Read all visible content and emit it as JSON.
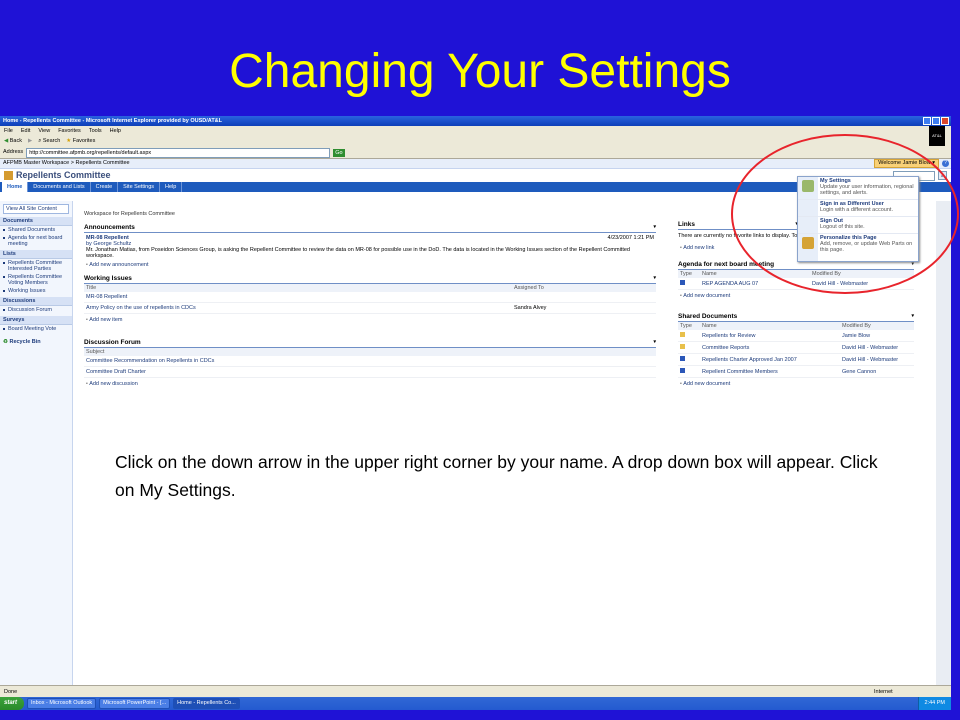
{
  "slide": {
    "title": "Changing Your Settings",
    "caption": "Click on the down arrow in the upper right corner by your name.  A drop down box will appear.  Click on My Settings."
  },
  "browser": {
    "title": "Home - Repellents Committee - Microsoft Internet Explorer provided by OUSD/AT&L",
    "menu": [
      "File",
      "Edit",
      "View",
      "Favorites",
      "Tools",
      "Help"
    ],
    "toolbar": [
      "Back",
      "Search",
      "Favorites"
    ],
    "address_label": "Address",
    "address": "http://committee.afpmb.org/repellents/default.aspx",
    "go_label": "Go",
    "logo": "AT&L"
  },
  "sharepoint": {
    "breadcrumb": "AFPMB Master Workspace > Repellents Committee",
    "welcome": "Welcome Jamie Blow ▾",
    "help": "?",
    "site_title": "Repellents Committee",
    "search_go": "⌕",
    "tabs": [
      "Home",
      "Documents and Lists",
      "Create",
      "Site Settings",
      "Help"
    ],
    "leftnav": {
      "view_all": "View All Site Content",
      "sections": [
        {
          "heading": "Documents",
          "items": [
            "Shared Documents",
            "Agenda for next board meeting"
          ]
        },
        {
          "heading": "Lists",
          "items": [
            "Repellents Committee Interested Parties",
            "Repellents Committee Voting Members",
            "Working Issues"
          ]
        },
        {
          "heading": "Discussions",
          "items": [
            "Discussion Forum"
          ]
        },
        {
          "heading": "Surveys",
          "items": [
            "Board Meeting Vote"
          ]
        }
      ],
      "recycle": "Recycle Bin"
    },
    "workspace_label": "Workspace for Repellents Committee",
    "announcements": {
      "title": "Announcements",
      "item_title": "MR-08 Repellent",
      "item_date": "4/23/2007 1:21 PM",
      "item_by": "by George Schultz",
      "item_body": "Mr. Jonathan Matias, from Poseidon Sciences Group, is asking the Repellent Committee to review the data on MR-08 for possible use in the DoD.  The data is located in the Working Issues section of the Repellent Committed workspace.",
      "add": "Add new announcement"
    },
    "working_issues": {
      "title": "Working Issues",
      "col_title": "Title",
      "col_assigned": "Assigned To",
      "rows": [
        {
          "title": "MR-08 Repellent",
          "assigned": ""
        },
        {
          "title": "Army Policy on the use of repellents in CDCs",
          "assigned": "Sandra Alvey"
        }
      ],
      "add": "Add new item"
    },
    "discussion": {
      "title": "Discussion Forum",
      "col_subject": "Subject",
      "rows": [
        "Committee Recommendation on Repellents in CDCs",
        "Committee Draft Charter"
      ],
      "add": "Add new discussion"
    },
    "links": {
      "title": "Links",
      "empty": "There are currently no favorite links to display. To",
      "add": "Add new link"
    },
    "agenda": {
      "title": "Agenda for next board meeting",
      "col_type": "Type",
      "col_name": "Name",
      "col_modified": "Modified By",
      "rows": [
        {
          "name": "REP AGENDA AUG 07",
          "modified": "David Hill - Webmaster"
        }
      ],
      "add": "Add new document"
    },
    "shared_docs": {
      "title": "Shared Documents",
      "col_type": "Type",
      "col_name": "Name",
      "col_modified": "Modified By",
      "rows": [
        {
          "name": "Repellents for Review",
          "modified": "Jamie Blow",
          "kind": "folder"
        },
        {
          "name": "Committee Reports",
          "modified": "David Hill - Webmaster",
          "kind": "folder"
        },
        {
          "name": "Repellents Charter Approved Jan 2007",
          "modified": "David Hill - Webmaster",
          "kind": "doc"
        },
        {
          "name": "Repellent Committee Members",
          "modified": "Gene Cannon",
          "kind": "doc"
        }
      ],
      "add": "Add new document"
    },
    "menu": [
      {
        "title": "My Settings",
        "desc": "Update your user information, regional settings, and alerts."
      },
      {
        "title": "Sign in as Different User",
        "desc": "Login with a different account."
      },
      {
        "title": "Sign Out",
        "desc": "Logout of this site."
      },
      {
        "title": "Personalize this Page",
        "desc": "Add, remove, or update Web Parts on this page."
      }
    ]
  },
  "status": {
    "left": "Done",
    "zone": "Internet"
  },
  "taskbar": {
    "start": "start",
    "buttons": [
      "Inbox - Microsoft Outlook",
      "Microsoft PowerPoint - [...",
      "Home - Repellents Co..."
    ],
    "clock": "2:44 PM"
  },
  "colors": {
    "slide_bg": "#1f12d6",
    "title": "#ffff00",
    "highlight_circle": "#e8242c",
    "tab_bar": "#1e5bbd"
  }
}
